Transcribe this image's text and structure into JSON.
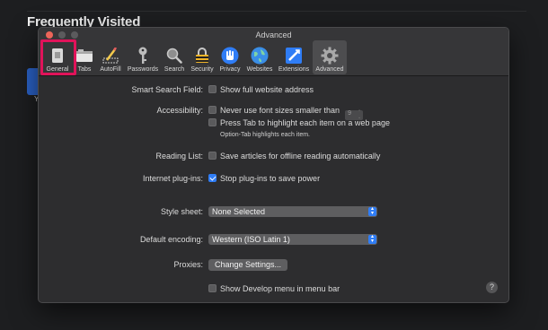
{
  "background": {
    "title": "Frequently Visited",
    "tile_label": "Y"
  },
  "window": {
    "title": "Advanced",
    "tabs": [
      {
        "label": "General",
        "icon": "general-icon"
      },
      {
        "label": "Tabs",
        "icon": "tabs-icon"
      },
      {
        "label": "AutoFill",
        "icon": "autofill-icon"
      },
      {
        "label": "Passwords",
        "icon": "key-icon"
      },
      {
        "label": "Search",
        "icon": "search-icon"
      },
      {
        "label": "Security",
        "icon": "lock-icon"
      },
      {
        "label": "Privacy",
        "icon": "hand-icon"
      },
      {
        "label": "Websites",
        "icon": "globe-icon"
      },
      {
        "label": "Extensions",
        "icon": "puzzle-icon"
      },
      {
        "label": "Advanced",
        "icon": "gear-icon"
      }
    ],
    "active_tab": "Advanced",
    "highlighted_tab": "General"
  },
  "settings": {
    "smart_search": {
      "label": "Smart Search Field:",
      "option": "Show full website address",
      "checked": false
    },
    "accessibility": {
      "label": "Accessibility:",
      "font_option": "Never use font sizes smaller than",
      "font_value": "9",
      "tab_option": "Press Tab to highlight each item on a web page",
      "tab_note": "Option-Tab highlights each item."
    },
    "reading_list": {
      "label": "Reading List:",
      "option": "Save articles for offline reading automatically"
    },
    "plugins": {
      "label": "Internet plug-ins:",
      "option": "Stop plug-ins to save power",
      "checked": true
    },
    "style_sheet": {
      "label": "Style sheet:",
      "value": "None Selected"
    },
    "encoding": {
      "label": "Default encoding:",
      "value": "Western (ISO Latin 1)"
    },
    "proxies": {
      "label": "Proxies:",
      "button": "Change Settings..."
    },
    "develop": {
      "option": "Show Develop menu in menu bar"
    },
    "help": "?"
  },
  "colors": {
    "accent": "#2f7df6",
    "highlight": "#e0135a",
    "window_bg": "#2d2d2f"
  }
}
